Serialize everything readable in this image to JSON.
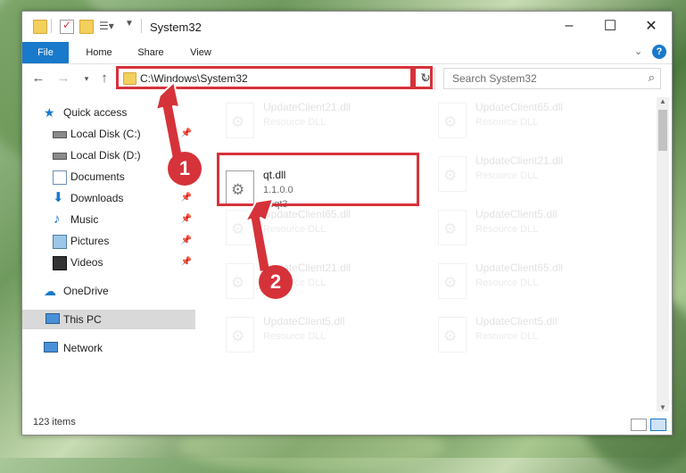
{
  "window": {
    "title": "System32"
  },
  "ribbon": {
    "tabs": [
      "File",
      "Home",
      "Share",
      "View"
    ]
  },
  "address": {
    "path": "C:\\Windows\\System32",
    "search_placeholder": "Search System32"
  },
  "nav": {
    "quick_access": "Quick access",
    "items": [
      "Local Disk (C:)",
      "Local Disk (D:)",
      "Documents",
      "Downloads",
      "Music",
      "Pictures",
      "Videos"
    ],
    "onedrive": "OneDrive",
    "this_pc": "This PC",
    "network": "Network"
  },
  "files": {
    "selected": {
      "name": "qt.dll",
      "version": "1.1.0.0",
      "company": "aeqt3"
    },
    "bg": [
      {
        "name": "UpdateClient21.dll",
        "type": "Resource DLL"
      },
      {
        "name": "UpdateClient65.dll",
        "type": "Resource DLL"
      },
      {
        "name": "UpdateClient21.dll",
        "type": "Resource DLL"
      },
      {
        "name": "UpdateClient65.dll",
        "type": "Resource DLL"
      },
      {
        "name": "UpdateClient5.dll",
        "type": "Resource DLL"
      },
      {
        "name": "UpdateClient21.dll",
        "type": "Resource DLL"
      },
      {
        "name": "UpdateClient65.dll",
        "type": "Resource DLL"
      },
      {
        "name": "UpdateClient5.dll",
        "type": "Resource DLL"
      },
      {
        "name": "UpdateClient5.dll",
        "type": "Resource DLL"
      }
    ]
  },
  "status": {
    "count": "123 items"
  },
  "markers": {
    "one": "1",
    "two": "2"
  },
  "colors": {
    "accent": "#1979ca",
    "highlight": "#d6323a"
  }
}
